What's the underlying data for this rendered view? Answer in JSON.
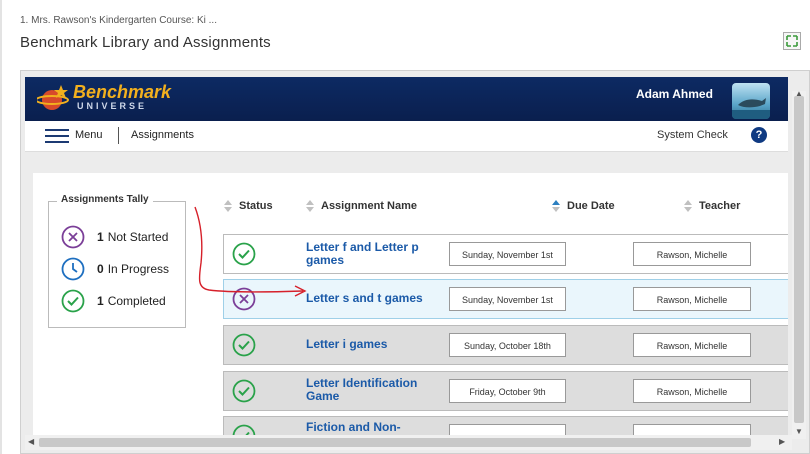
{
  "breadcrumb": "1. Mrs. Rawson's Kindergarten Course: Ki ...",
  "page_title": "Benchmark Library and Assignments",
  "header": {
    "logo_main": "Benchmark",
    "logo_sub": "UNIVERSE",
    "user_name": "Adam Ahmed"
  },
  "nav": {
    "menu_label": "Menu",
    "assignments_label": "Assignments",
    "system_check_label": "System Check",
    "help_label": "?"
  },
  "tally": {
    "title": "Assignments Tally",
    "items": [
      {
        "count": "1",
        "label": "Not Started",
        "icon": "x-circle-icon",
        "color": "#7b3f98"
      },
      {
        "count": "0",
        "label": "In Progress",
        "icon": "clock-icon",
        "color": "#1e6fc0"
      },
      {
        "count": "1",
        "label": "Completed",
        "icon": "check-circle-icon",
        "color": "#2aa24a"
      }
    ]
  },
  "columns": {
    "status": "Status",
    "name": "Assignment Name",
    "due": "Due Date",
    "teacher": "Teacher"
  },
  "rows": [
    {
      "status": "completed",
      "name": "Letter f and Letter p games",
      "due": "Sunday, November 1st",
      "teacher": "Rawson, Michelle"
    },
    {
      "status": "not-started",
      "name": "Letter s and t games",
      "due": "Sunday, November 1st",
      "teacher": "Rawson, Michelle"
    },
    {
      "status": "completed",
      "name": "Letter i games",
      "due": "Sunday, October 18th",
      "teacher": "Rawson, Michelle"
    },
    {
      "status": "completed",
      "name": "Letter Identification Game",
      "due": "Friday, October 9th",
      "teacher": "Rawson, Michelle"
    },
    {
      "status": "completed",
      "name": "Fiction and Non-Fiction Pict...",
      "due": "",
      "teacher": ""
    }
  ],
  "colors": {
    "header_bg": "#0d2a63",
    "link_blue": "#1b5aa8",
    "annotation_red": "#d6202a"
  }
}
